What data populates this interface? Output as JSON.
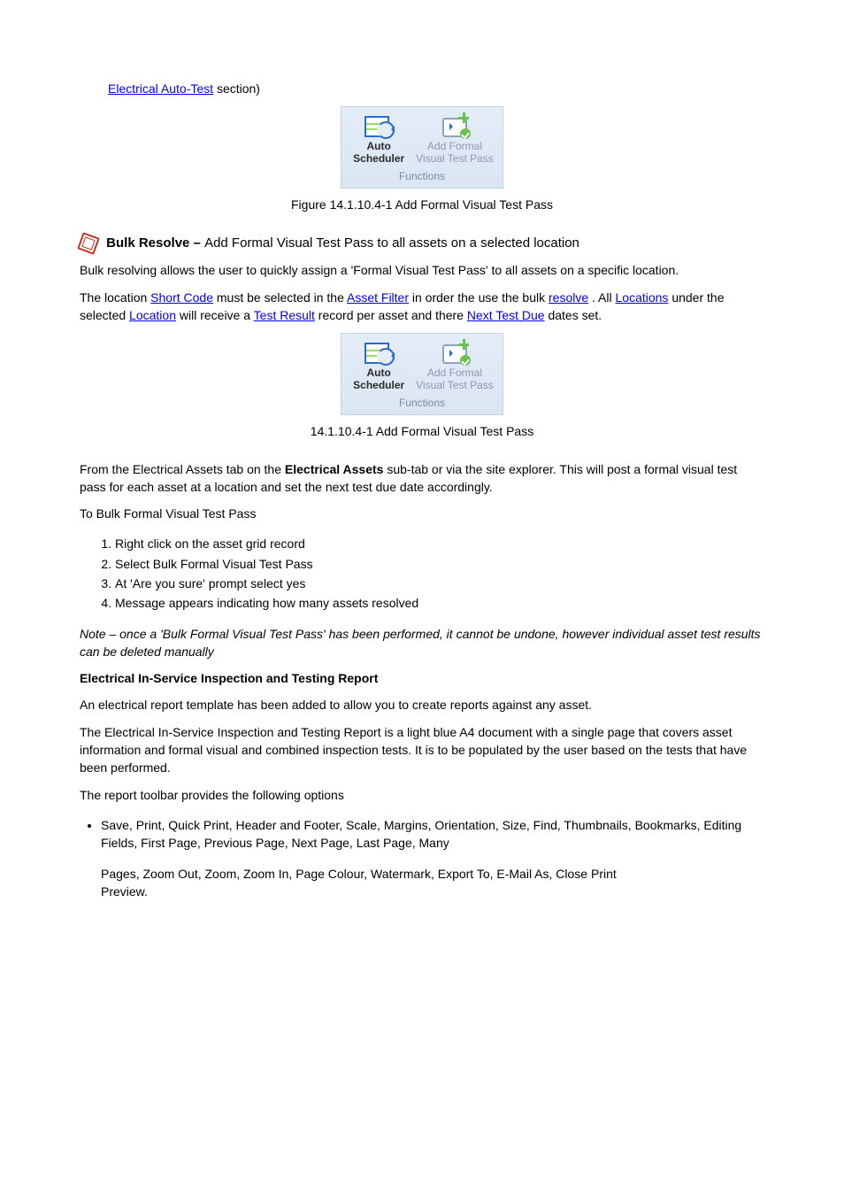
{
  "intro_link": {
    "text": "Electrical Auto-Test"
  },
  "intro_tail": " section)",
  "figure1": {
    "btn1_line1": "Auto",
    "btn1_line2": "Scheduler",
    "btn2_line1": "Add Formal",
    "btn2_line2": "Visual Test Pass",
    "group_label": "Functions",
    "caption": "Figure 14.1.10.4-1 Add Formal Visual Test Pass"
  },
  "bulk_resolve": {
    "heading_main": "Bulk Resolve – ",
    "heading_sub": "Add Formal Visual Test Pass to all assets on a selected location",
    "p1": "Bulk resolving allows the user to quickly assign a 'Formal Visual Test Pass' to all assets on a specific location.",
    "p2_prefix": "The location ",
    "p2_link1": "Short Code",
    "p2_mid1": " must be selected in the ",
    "p2_link2": "Asset Filter",
    "p2_mid2": " in order the use the bulk ",
    "p2_link3": "resolve",
    "p2_mid3": ". All ",
    "p2_link4": "Locations",
    "p2_tail": " under the selected ",
    "p3_link1": "Location",
    "p3_mid1": " will receive a ",
    "p3_link2": "Test Result",
    "p3_mid2": " record per asset and there ",
    "p3_link3": "Next Test Due",
    "p3_tail": " dates set.",
    "figure": {
      "btn1_line1": "Auto",
      "btn1_line2": "Scheduler",
      "btn2_line1": "Add Formal",
      "btn2_line2": "Visual Test Pass",
      "group_label": "Functions",
      "caption": "14.1.10.4-1 Add Formal Visual Test Pass"
    },
    "p4_pre": "From the Electrical Assets tab on the ",
    "p4_bold": "Electrical Assets",
    "p4_post": " sub-tab or via the site explorer. This will post a formal visual test pass for each asset at a location and set the next test due date accordingly.",
    "steps_intro": "To Bulk Formal Visual Test Pass",
    "steps": [
      "Right click on the asset grid record",
      "Select Bulk Formal Visual Test Pass",
      "At 'Are you sure' prompt select yes",
      "Message appears indicating how many assets resolved"
    ],
    "note": "Note – once a 'Bulk Formal Visual Test Pass' has been performed, it cannot be undone, however individual asset test results can be deleted manually"
  },
  "report": {
    "heading": "Electrical In-Service Inspection and Testing Report",
    "p1": "An electrical report template has been added to allow you to create reports against any asset.",
    "p2": "The Electrical In-Service Inspection and Testing Report is a light blue A4 document with a single page that covers asset information and formal visual and combined inspection tests. It is to be populated by the user based on the tests that have been performed.",
    "toolbar_intro": "The report toolbar provides the following options",
    "toolbar_items": [
      "Save, Print, Quick Print, Header and Footer, Scale, Margins, Orientation, Size, Find, Thumbnails, Bookmarks, Editing Fields, First Page, Previous Page, Next Page, Last Page, Many",
      "Pages, Zoom Out, Zoom, Zoom In, Page Colour, Watermark, Export To, E-Mail As, Close Print",
      "Preview."
    ]
  }
}
